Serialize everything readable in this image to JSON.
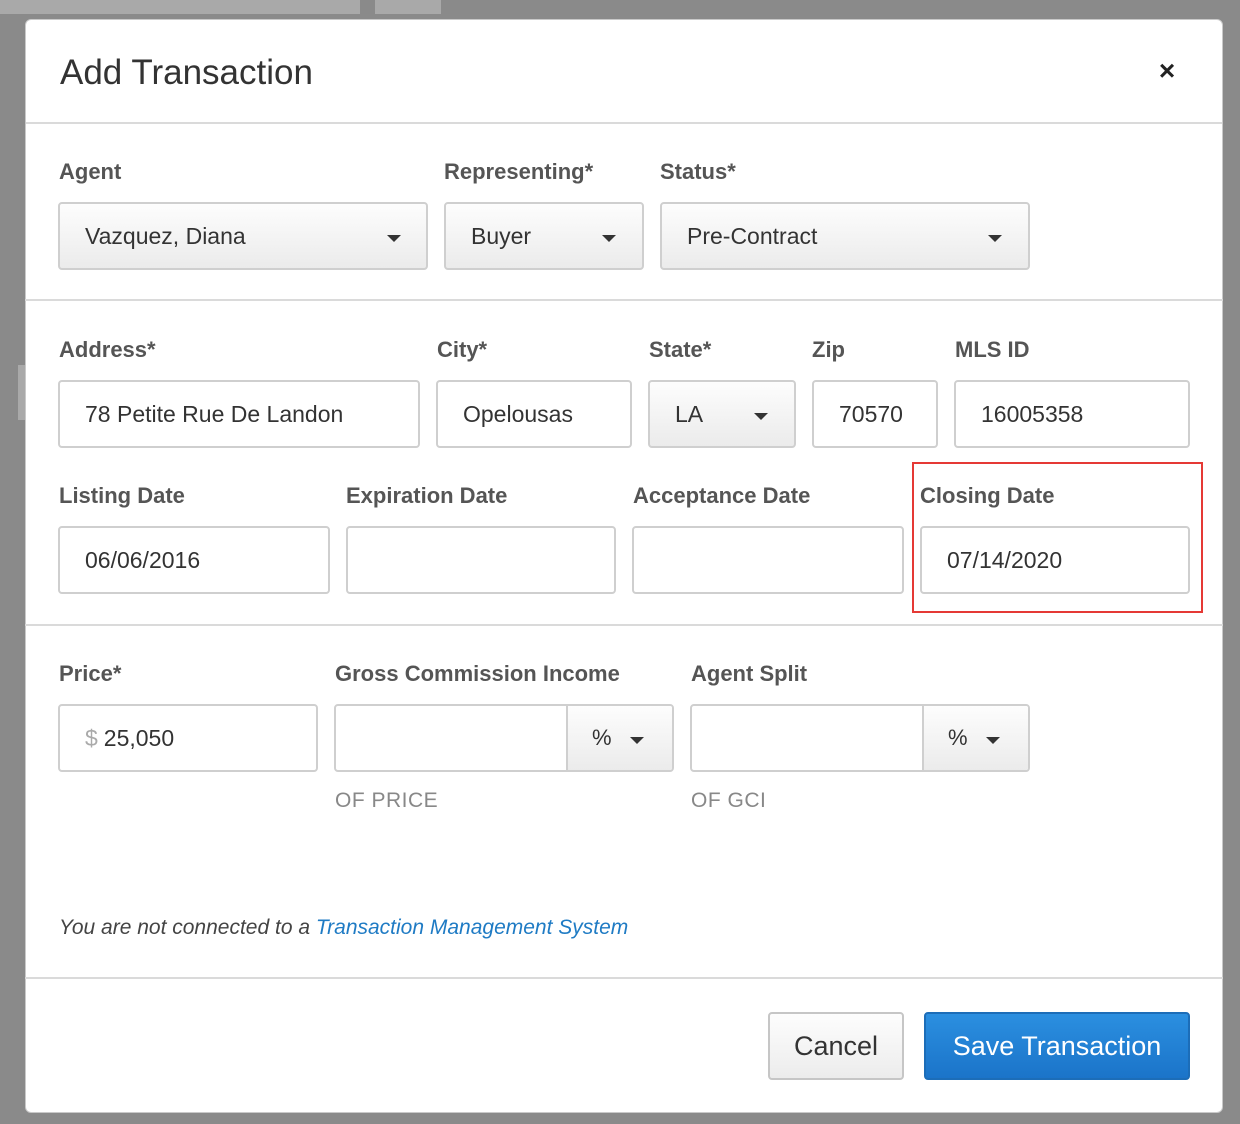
{
  "modal": {
    "title": "Add Transaction",
    "close_label": "×"
  },
  "fields": {
    "agent": {
      "label": "Agent",
      "value": "Vazquez, Diana"
    },
    "representing": {
      "label": "Representing*",
      "value": "Buyer"
    },
    "status": {
      "label": "Status*",
      "value": "Pre-Contract"
    },
    "address": {
      "label": "Address*",
      "value": "78 Petite Rue De Landon"
    },
    "city": {
      "label": "City*",
      "value": "Opelousas"
    },
    "state": {
      "label": "State*",
      "value": "LA"
    },
    "zip": {
      "label": "Zip",
      "value": "70570"
    },
    "mls_id": {
      "label": "MLS ID",
      "value": "16005358"
    },
    "listing_date": {
      "label": "Listing Date",
      "value": "06/06/2016"
    },
    "expiration_date": {
      "label": "Expiration Date",
      "value": ""
    },
    "acceptance_date": {
      "label": "Acceptance Date",
      "value": ""
    },
    "closing_date": {
      "label": "Closing Date",
      "value": "07/14/2020"
    },
    "price": {
      "label": "Price*",
      "currency": "$",
      "value": "25,050"
    },
    "gci": {
      "label": "Gross Commission Income",
      "value": "",
      "unit": "%",
      "hint": "OF PRICE"
    },
    "agent_split": {
      "label": "Agent Split",
      "value": "",
      "unit": "%",
      "hint": "OF GCI"
    }
  },
  "note": {
    "text": "You are not connected to a ",
    "link": "Transaction Management System"
  },
  "buttons": {
    "cancel": "Cancel",
    "save": "Save Transaction"
  },
  "colors": {
    "primary": "#1f7bc4",
    "highlight": "#e53935"
  }
}
